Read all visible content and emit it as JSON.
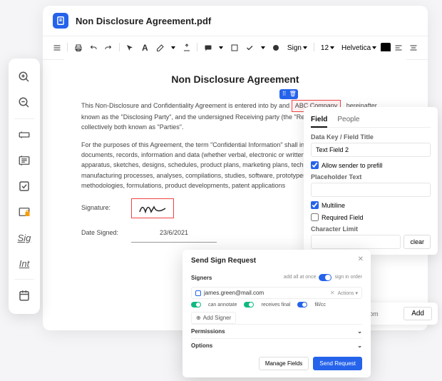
{
  "window": {
    "title": "Non Disclosure Agreement.pdf"
  },
  "toolbar": {
    "sign_label": "Sign",
    "font_size": "12",
    "font_family": "Helvetica"
  },
  "doc": {
    "title": "Non Disclosure Agreement",
    "p1_prefix": "This Non-Disclosure and Confidentiality Agreement is entered into by and",
    "company_field": "ABC Company",
    "p1_suffix": ", hereinafter known as the \"Disclosing Party\", and the undersigned Receiving party (the \"Receiving Party\"), and collectively both known as \"Parties\".",
    "p2": "For the purposes of this Agreement, the term \"Confidential Information\" shall include, but not be limited to, documents, records, information and data (whether verbal, electronic or written), drawings, models, apparatus, sketches, designs, schedules, product plans, marketing plans, technical procedures, manufacturing processes, analyses, compilations, studies, software, prototypes, samples, formulas, methodologies, formulations, product developments, patent applications",
    "sig_label": "Signature:",
    "date_label": "Date Signed:",
    "date_value": "23/6/2021"
  },
  "left_tools": {
    "sig": "Sig",
    "int": "Int"
  },
  "panel": {
    "tab_field": "Field",
    "tab_people": "People",
    "datakey_label": "Data Key / Field Title",
    "datakey_value": "Text Field 2",
    "allow_prefill": "Allow sender to prefill",
    "placeholder_label": "Placeholder Text",
    "multiline": "Multiline",
    "required": "Required Field",
    "charlimit_label": "Character Limit",
    "clear": "clear"
  },
  "add": {
    "placeholder": "example@example.com",
    "btn": "Add"
  },
  "modal": {
    "title": "Send Sign Request",
    "signers": "Signers",
    "add_at_once": "add all at once",
    "sign_in_order": "sign in order",
    "email": "james.green@mail.com",
    "actions": "Actions",
    "can_annotate": "can annotate",
    "receives_final": "receives final",
    "fill_cc": "fill/cc",
    "add_signer": "Add Signer",
    "permissions": "Permissions",
    "options": "Options",
    "manage": "Manage Fields",
    "send": "Send Request"
  }
}
